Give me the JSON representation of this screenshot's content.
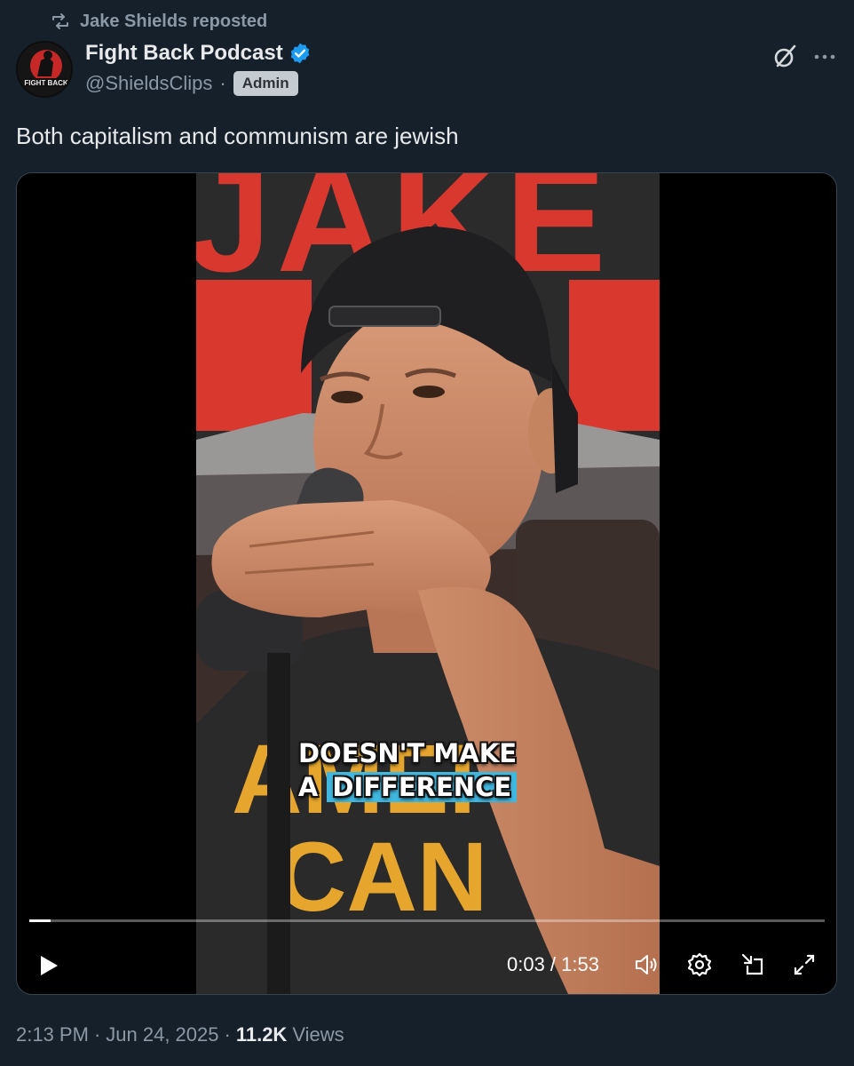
{
  "repost": {
    "text": "Jake Shields reposted",
    "icon": "repost-icon"
  },
  "author": {
    "name": "Fight Back Podcast",
    "handle": "@ShieldsClips",
    "separator": "·",
    "badge": "Admin",
    "avatar_text": "FIGHT BACK",
    "verified": true
  },
  "tweet": {
    "text": "Both capitalism and communism are jewish"
  },
  "video": {
    "caption_line1": "DOESN'T MAKE",
    "caption_line2_prefix": "A",
    "caption_line2_highlight": "DIFFERENCE",
    "backdrop_letters": "JAKE",
    "shirt_letters_1": "AMER",
    "shirt_letters_2": "CAN",
    "current_time": "0:03",
    "duration": "1:53",
    "time_display": "0:03 / 1:53",
    "progress_fraction": 0.027,
    "caption_highlight_color": "#3fb7df"
  },
  "footer": {
    "time": "2:13 PM",
    "dot1": "·",
    "date": "Jun 24, 2025",
    "dot2": "·",
    "views_count": "11.2K",
    "views_label": "Views"
  },
  "colors": {
    "background": "#15202b",
    "text_primary": "#e7e9ea",
    "text_secondary": "#8b98a5",
    "verified_blue": "#1d9bf0",
    "backdrop_red": "#d9382f"
  }
}
